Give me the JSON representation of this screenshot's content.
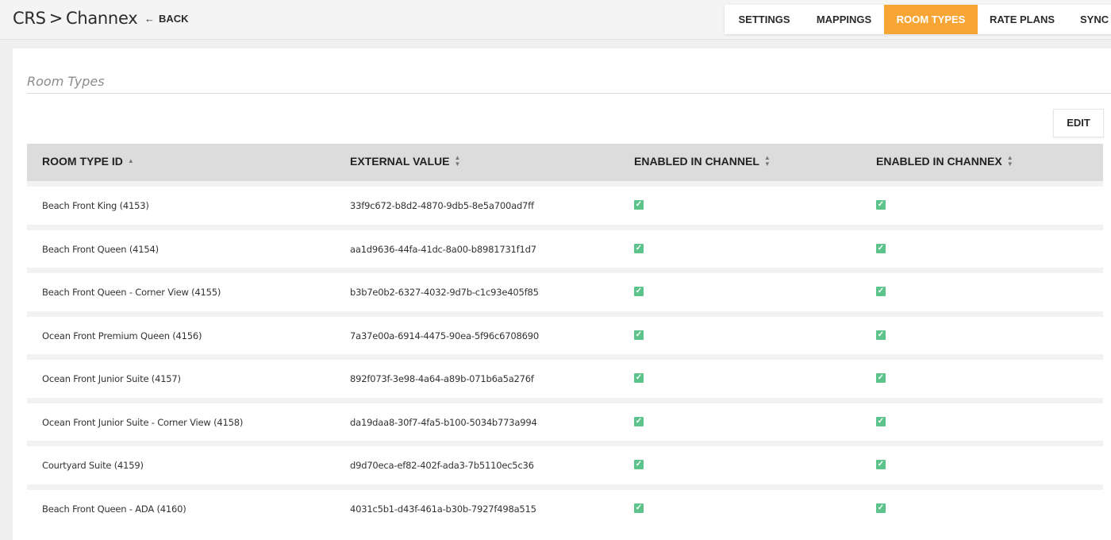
{
  "header": {
    "crumb_root": "CRS",
    "crumb_sep": ">",
    "crumb_current": "Channex",
    "back_label": "BACK",
    "back_icon": "left-arrow-icon",
    "tabs": [
      {
        "label": "SETTINGS",
        "active": false
      },
      {
        "label": "MAPPINGS",
        "active": false
      },
      {
        "label": "ROOM TYPES",
        "active": true
      },
      {
        "label": "RATE PLANS",
        "active": false
      },
      {
        "label": "SYNC",
        "active": false
      }
    ]
  },
  "panel": {
    "title": "Room Types",
    "edit_label": "EDIT"
  },
  "table": {
    "columns": [
      {
        "label": "ROOM TYPE ID",
        "sort": "ascending"
      },
      {
        "label": "EXTERNAL VALUE",
        "sort": "none"
      },
      {
        "label": "ENABLED IN CHANNEL",
        "sort": "none"
      },
      {
        "label": "ENABLED IN CHANNEX",
        "sort": "none"
      }
    ],
    "rows": [
      {
        "room_type": "Beach Front King (4153)",
        "external_value": "33f9c672-b8d2-4870-9db5-8e5a700ad7ff",
        "enabled_channel": true,
        "enabled_channex": true
      },
      {
        "room_type": "Beach Front Queen (4154)",
        "external_value": "aa1d9636-44fa-41dc-8a00-b8981731f1d7",
        "enabled_channel": true,
        "enabled_channex": true
      },
      {
        "room_type": "Beach Front Queen - Corner View (4155)",
        "external_value": "b3b7e0b2-6327-4032-9d7b-c1c93e405f85",
        "enabled_channel": true,
        "enabled_channex": true
      },
      {
        "room_type": "Ocean Front Premium Queen (4156)",
        "external_value": "7a37e00a-6914-4475-90ea-5f96c6708690",
        "enabled_channel": true,
        "enabled_channex": true
      },
      {
        "room_type": "Ocean Front Junior Suite (4157)",
        "external_value": "892f073f-3e98-4a64-a89b-071b6a5a276f",
        "enabled_channel": true,
        "enabled_channex": true
      },
      {
        "room_type": "Ocean Front Junior Suite - Corner View (4158)",
        "external_value": "da19daa8-30f7-4fa5-b100-5034b773a994",
        "enabled_channel": true,
        "enabled_channex": true
      },
      {
        "room_type": "Courtyard Suite (4159)",
        "external_value": "d9d70eca-ef82-402f-ada3-7b5110ec5c36",
        "enabled_channel": true,
        "enabled_channex": true
      },
      {
        "room_type": "Beach Front Queen - ADA (4160)",
        "external_value": "4031c5b1-d43f-461a-b30b-7927f498a515",
        "enabled_channel": true,
        "enabled_channex": true
      }
    ]
  },
  "colors": {
    "accent": "#f7a535",
    "check": "#5cc48b",
    "header_bg": "#dcdcdc"
  }
}
